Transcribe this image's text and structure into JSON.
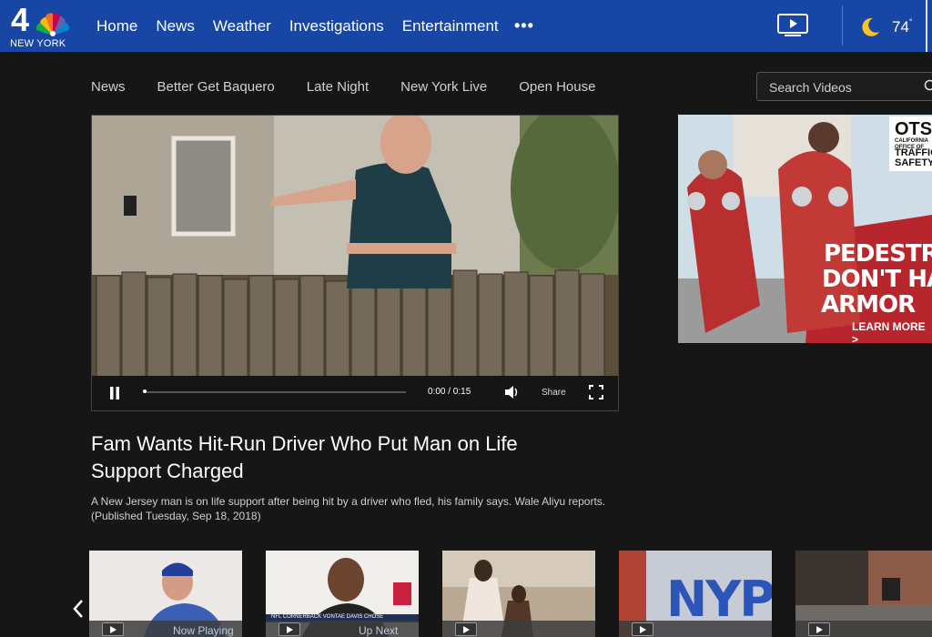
{
  "header": {
    "logo_number": "4",
    "logo_city": "NEW YORK",
    "nav": [
      "Home",
      "News",
      "Weather",
      "Investigations",
      "Entertainment"
    ],
    "more_icon": "ellipsis-icon",
    "tv_icon": "tv-play-icon",
    "weather_icon": "moon-icon",
    "temperature": "74",
    "degree_symbol": "°",
    "brand_color": "#1746a5"
  },
  "subnav": {
    "items": [
      "News",
      "Better Get Baquero",
      "Late Night",
      "New York Live",
      "Open House"
    ],
    "search_placeholder": "Search Videos"
  },
  "player": {
    "time": "0:00 / 0:15",
    "share_label": "Share",
    "progress": 0
  },
  "article": {
    "headline": "Fam Wants Hit-Run Driver Who Put Man on Life Support Charged",
    "description": "A New Jersey man is on life support after being hit by a driver who fled, his family says. Wale Aliyu reports. (Published Tuesday, Sep 18, 2018)"
  },
  "ad": {
    "brand": "OTS",
    "brand_sub": "CALIFORNIA OFFICE OF",
    "brand_lines": [
      "TRAFFIC",
      "SAFETY"
    ],
    "headline_lines": [
      "PEDESTRIANS",
      "DON'T HAVE",
      "ARMOR"
    ],
    "cta": "LEARN MORE >"
  },
  "thumbnails": [
    {
      "status": "Now Playing",
      "caption": ""
    },
    {
      "status": "Up Next",
      "caption": "NFL CORNERBACK VONTAE DAVIS CHOSE"
    },
    {
      "status": "",
      "caption": ""
    },
    {
      "status": "",
      "caption": "NYPD"
    },
    {
      "status": "",
      "caption": ""
    }
  ]
}
